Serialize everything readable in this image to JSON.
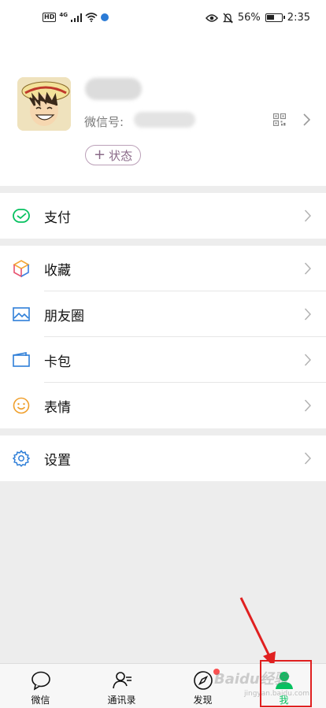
{
  "status_bar": {
    "hd": "HD",
    "network": "4G",
    "battery_percent": "56%",
    "battery_level": 0.56,
    "time": "2:35"
  },
  "profile": {
    "wechat_id_label": "微信号:",
    "status_button": "状态",
    "status_plus": "+"
  },
  "menu": {
    "pay": "支付",
    "favorites": "收藏",
    "moments": "朋友圈",
    "cards": "卡包",
    "stickers": "表情",
    "settings": "设置"
  },
  "tabs": [
    {
      "label": "微信",
      "icon": "chat-icon"
    },
    {
      "label": "通讯录",
      "icon": "contacts-icon"
    },
    {
      "label": "发现",
      "icon": "discover-icon"
    },
    {
      "label": "我",
      "icon": "me-icon",
      "active": true
    }
  ],
  "watermark": "Baidu经验",
  "watermark_sub": "jingyan.baidu.com",
  "colors": {
    "accent_green": "#07c160",
    "highlight_red": "#e02020",
    "badge_red": "#fa5151"
  }
}
